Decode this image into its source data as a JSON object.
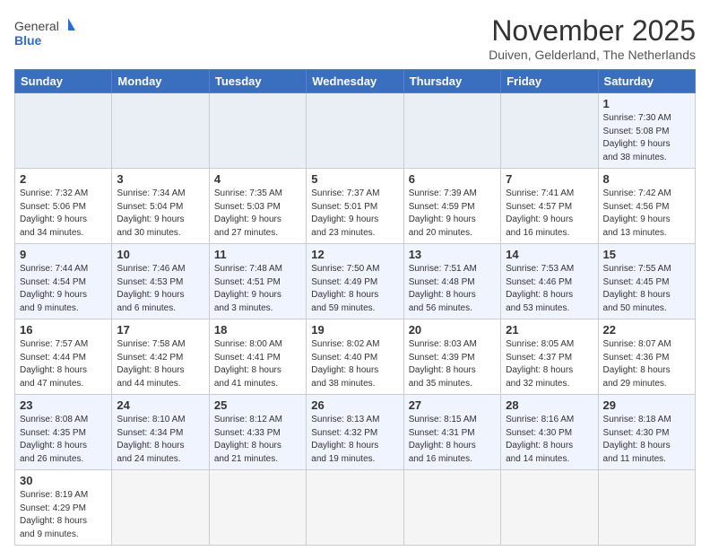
{
  "header": {
    "logo_general": "General",
    "logo_blue": "Blue",
    "month_title": "November 2025",
    "location": "Duiven, Gelderland, The Netherlands"
  },
  "days_of_week": [
    "Sunday",
    "Monday",
    "Tuesday",
    "Wednesday",
    "Thursday",
    "Friday",
    "Saturday"
  ],
  "weeks": [
    [
      {
        "day": "",
        "info": ""
      },
      {
        "day": "",
        "info": ""
      },
      {
        "day": "",
        "info": ""
      },
      {
        "day": "",
        "info": ""
      },
      {
        "day": "",
        "info": ""
      },
      {
        "day": "",
        "info": ""
      },
      {
        "day": "1",
        "info": "Sunrise: 7:30 AM\nSunset: 5:08 PM\nDaylight: 9 hours\nand 38 minutes."
      }
    ],
    [
      {
        "day": "2",
        "info": "Sunrise: 7:32 AM\nSunset: 5:06 PM\nDaylight: 9 hours\nand 34 minutes."
      },
      {
        "day": "3",
        "info": "Sunrise: 7:34 AM\nSunset: 5:04 PM\nDaylight: 9 hours\nand 30 minutes."
      },
      {
        "day": "4",
        "info": "Sunrise: 7:35 AM\nSunset: 5:03 PM\nDaylight: 9 hours\nand 27 minutes."
      },
      {
        "day": "5",
        "info": "Sunrise: 7:37 AM\nSunset: 5:01 PM\nDaylight: 9 hours\nand 23 minutes."
      },
      {
        "day": "6",
        "info": "Sunrise: 7:39 AM\nSunset: 4:59 PM\nDaylight: 9 hours\nand 20 minutes."
      },
      {
        "day": "7",
        "info": "Sunrise: 7:41 AM\nSunset: 4:57 PM\nDaylight: 9 hours\nand 16 minutes."
      },
      {
        "day": "8",
        "info": "Sunrise: 7:42 AM\nSunset: 4:56 PM\nDaylight: 9 hours\nand 13 minutes."
      }
    ],
    [
      {
        "day": "9",
        "info": "Sunrise: 7:44 AM\nSunset: 4:54 PM\nDaylight: 9 hours\nand 9 minutes."
      },
      {
        "day": "10",
        "info": "Sunrise: 7:46 AM\nSunset: 4:53 PM\nDaylight: 9 hours\nand 6 minutes."
      },
      {
        "day": "11",
        "info": "Sunrise: 7:48 AM\nSunset: 4:51 PM\nDaylight: 9 hours\nand 3 minutes."
      },
      {
        "day": "12",
        "info": "Sunrise: 7:50 AM\nSunset: 4:49 PM\nDaylight: 8 hours\nand 59 minutes."
      },
      {
        "day": "13",
        "info": "Sunrise: 7:51 AM\nSunset: 4:48 PM\nDaylight: 8 hours\nand 56 minutes."
      },
      {
        "day": "14",
        "info": "Sunrise: 7:53 AM\nSunset: 4:46 PM\nDaylight: 8 hours\nand 53 minutes."
      },
      {
        "day": "15",
        "info": "Sunrise: 7:55 AM\nSunset: 4:45 PM\nDaylight: 8 hours\nand 50 minutes."
      }
    ],
    [
      {
        "day": "16",
        "info": "Sunrise: 7:57 AM\nSunset: 4:44 PM\nDaylight: 8 hours\nand 47 minutes."
      },
      {
        "day": "17",
        "info": "Sunrise: 7:58 AM\nSunset: 4:42 PM\nDaylight: 8 hours\nand 44 minutes."
      },
      {
        "day": "18",
        "info": "Sunrise: 8:00 AM\nSunset: 4:41 PM\nDaylight: 8 hours\nand 41 minutes."
      },
      {
        "day": "19",
        "info": "Sunrise: 8:02 AM\nSunset: 4:40 PM\nDaylight: 8 hours\nand 38 minutes."
      },
      {
        "day": "20",
        "info": "Sunrise: 8:03 AM\nSunset: 4:39 PM\nDaylight: 8 hours\nand 35 minutes."
      },
      {
        "day": "21",
        "info": "Sunrise: 8:05 AM\nSunset: 4:37 PM\nDaylight: 8 hours\nand 32 minutes."
      },
      {
        "day": "22",
        "info": "Sunrise: 8:07 AM\nSunset: 4:36 PM\nDaylight: 8 hours\nand 29 minutes."
      }
    ],
    [
      {
        "day": "23",
        "info": "Sunrise: 8:08 AM\nSunset: 4:35 PM\nDaylight: 8 hours\nand 26 minutes."
      },
      {
        "day": "24",
        "info": "Sunrise: 8:10 AM\nSunset: 4:34 PM\nDaylight: 8 hours\nand 24 minutes."
      },
      {
        "day": "25",
        "info": "Sunrise: 8:12 AM\nSunset: 4:33 PM\nDaylight: 8 hours\nand 21 minutes."
      },
      {
        "day": "26",
        "info": "Sunrise: 8:13 AM\nSunset: 4:32 PM\nDaylight: 8 hours\nand 19 minutes."
      },
      {
        "day": "27",
        "info": "Sunrise: 8:15 AM\nSunset: 4:31 PM\nDaylight: 8 hours\nand 16 minutes."
      },
      {
        "day": "28",
        "info": "Sunrise: 8:16 AM\nSunset: 4:30 PM\nDaylight: 8 hours\nand 14 minutes."
      },
      {
        "day": "29",
        "info": "Sunrise: 8:18 AM\nSunset: 4:30 PM\nDaylight: 8 hours\nand 11 minutes."
      }
    ],
    [
      {
        "day": "30",
        "info": "Sunrise: 8:19 AM\nSunset: 4:29 PM\nDaylight: 8 hours\nand 9 minutes."
      },
      {
        "day": "",
        "info": ""
      },
      {
        "day": "",
        "info": ""
      },
      {
        "day": "",
        "info": ""
      },
      {
        "day": "",
        "info": ""
      },
      {
        "day": "",
        "info": ""
      },
      {
        "day": "",
        "info": ""
      }
    ]
  ]
}
